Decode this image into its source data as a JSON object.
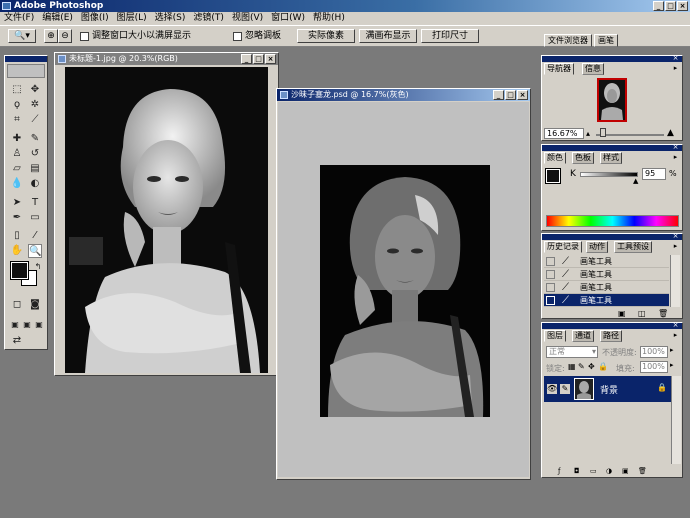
{
  "app": {
    "title": "Adobe Photoshop"
  },
  "menu": [
    "文件(F)",
    "编辑(E)",
    "图像(I)",
    "图层(L)",
    "选择(S)",
    "滤镜(T)",
    "视图(V)",
    "窗口(W)",
    "帮助(H)"
  ],
  "options": {
    "resize_window_label": "调整窗口大小以满屏显示",
    "ignore_palettes_label": "忽略调板",
    "actual_pixels": "实际像素",
    "fit_on_screen": "满画布显示",
    "print_size": "打印尺寸",
    "tab_file_browser": "文件浏览器",
    "tab_brushes": "画笔"
  },
  "docs": {
    "doc1_title": "未标题-1.jpg @ 20.3%(RGB)",
    "doc2_title": "沙昧子塞龙.psd @ 16.7%(灰色)"
  },
  "navigator": {
    "tab": "导航器",
    "tab2": "信息",
    "zoom": "16.67%"
  },
  "color": {
    "tab1": "颜色",
    "tab2": "色板",
    "tab3": "样式",
    "channel": "K",
    "value": "95",
    "unit": "%"
  },
  "history": {
    "tab1": "历史记录",
    "tab2": "动作",
    "tab3": "工具预设",
    "items": [
      "画笔工具",
      "画笔工具",
      "画笔工具",
      "画笔工具"
    ]
  },
  "layers": {
    "tab1": "图层",
    "tab2": "通道",
    "tab3": "路径",
    "blend": "正常",
    "opacity_label": "不透明度:",
    "opacity": "100%",
    "lock_label": "锁定:",
    "fill_label": "填充:",
    "fill": "100%",
    "layer_name": "背景"
  },
  "colors": {
    "titlebar": "#0a246a",
    "chrome": "#d4d0c8",
    "workspace": "#7a7a7a",
    "selection": "#0a246a"
  }
}
